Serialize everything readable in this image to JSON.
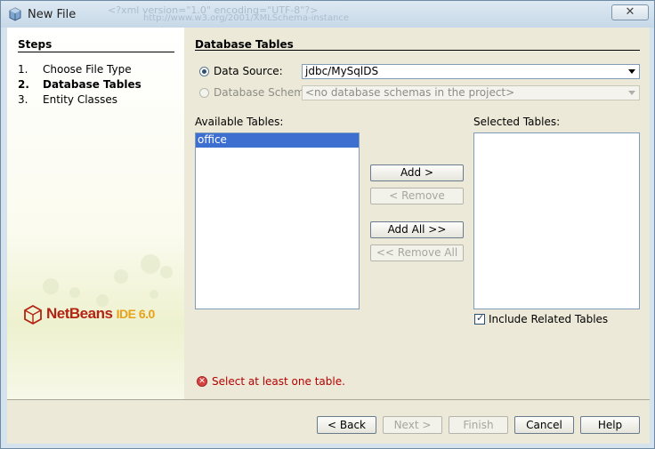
{
  "window": {
    "title": "New File",
    "close_label": "✕",
    "background_text_1": "<?xml version=\"1.0\" encoding=\"UTF-8\"?>",
    "background_text_2": "http://www.w3.org/2001/XMLSchema-instance"
  },
  "steps": {
    "title": "Steps",
    "items": [
      {
        "num": "1.",
        "label": "Choose File Type",
        "current": false
      },
      {
        "num": "2.",
        "label": "Database Tables",
        "current": true
      },
      {
        "num": "3.",
        "label": "Entity Classes",
        "current": false
      }
    ],
    "logo": {
      "brand": "NetBeans",
      "product": "IDE 6.0"
    }
  },
  "main": {
    "title": "Database Tables",
    "data_source": {
      "label": "Data Source:",
      "value": "jdbc/MySqlDS",
      "selected": true
    },
    "database_schema": {
      "label": "Database Schema",
      "value": "<no database schemas in the project>",
      "selected": false,
      "disabled": true
    },
    "available": {
      "label": "Available Tables:",
      "items": [
        "office"
      ],
      "selected_index": 0
    },
    "selected": {
      "label": "Selected Tables:",
      "items": []
    },
    "buttons": {
      "add": "Add >",
      "remove": "< Remove",
      "add_all": "Add All >>",
      "remove_all": "<< Remove All"
    },
    "include_related": {
      "label": "Include Related Tables",
      "checked": true
    },
    "error": "Select at least one table."
  },
  "footer": {
    "back": "< Back",
    "next": "Next >",
    "finish": "Finish",
    "cancel": "Cancel",
    "help": "Help"
  },
  "colors": {
    "selection": "#3d6fd0",
    "error": "#b40000",
    "logo_red": "#b32512",
    "logo_orange": "#e8a21a"
  }
}
